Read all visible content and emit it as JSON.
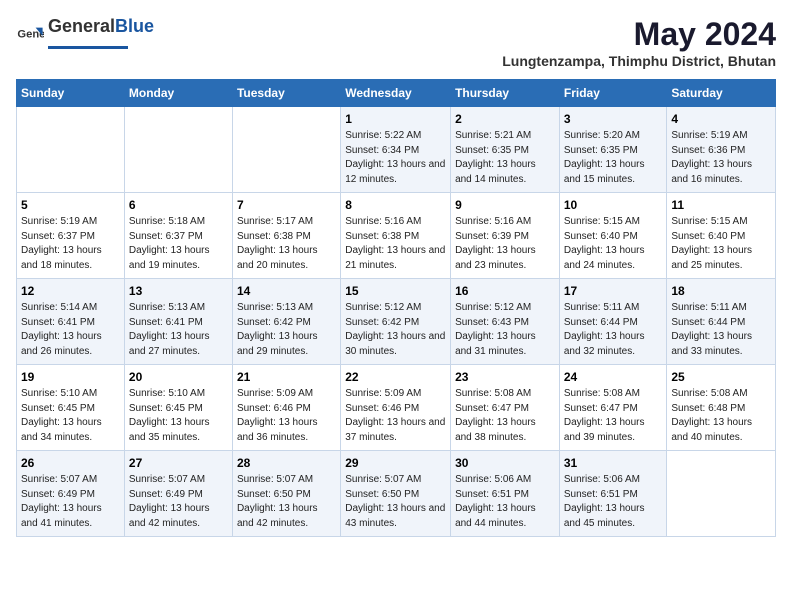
{
  "header": {
    "logo_general": "General",
    "logo_blue": "Blue",
    "title": "May 2024",
    "subtitle": "Lungtenzampa, Thimphu District, Bhutan"
  },
  "weekdays": [
    "Sunday",
    "Monday",
    "Tuesday",
    "Wednesday",
    "Thursday",
    "Friday",
    "Saturday"
  ],
  "weeks": [
    [
      {
        "day": "",
        "sunrise": "",
        "sunset": "",
        "daylight": ""
      },
      {
        "day": "",
        "sunrise": "",
        "sunset": "",
        "daylight": ""
      },
      {
        "day": "",
        "sunrise": "",
        "sunset": "",
        "daylight": ""
      },
      {
        "day": "1",
        "sunrise": "Sunrise: 5:22 AM",
        "sunset": "Sunset: 6:34 PM",
        "daylight": "Daylight: 13 hours and 12 minutes."
      },
      {
        "day": "2",
        "sunrise": "Sunrise: 5:21 AM",
        "sunset": "Sunset: 6:35 PM",
        "daylight": "Daylight: 13 hours and 14 minutes."
      },
      {
        "day": "3",
        "sunrise": "Sunrise: 5:20 AM",
        "sunset": "Sunset: 6:35 PM",
        "daylight": "Daylight: 13 hours and 15 minutes."
      },
      {
        "day": "4",
        "sunrise": "Sunrise: 5:19 AM",
        "sunset": "Sunset: 6:36 PM",
        "daylight": "Daylight: 13 hours and 16 minutes."
      }
    ],
    [
      {
        "day": "5",
        "sunrise": "Sunrise: 5:19 AM",
        "sunset": "Sunset: 6:37 PM",
        "daylight": "Daylight: 13 hours and 18 minutes."
      },
      {
        "day": "6",
        "sunrise": "Sunrise: 5:18 AM",
        "sunset": "Sunset: 6:37 PM",
        "daylight": "Daylight: 13 hours and 19 minutes."
      },
      {
        "day": "7",
        "sunrise": "Sunrise: 5:17 AM",
        "sunset": "Sunset: 6:38 PM",
        "daylight": "Daylight: 13 hours and 20 minutes."
      },
      {
        "day": "8",
        "sunrise": "Sunrise: 5:16 AM",
        "sunset": "Sunset: 6:38 PM",
        "daylight": "Daylight: 13 hours and 21 minutes."
      },
      {
        "day": "9",
        "sunrise": "Sunrise: 5:16 AM",
        "sunset": "Sunset: 6:39 PM",
        "daylight": "Daylight: 13 hours and 23 minutes."
      },
      {
        "day": "10",
        "sunrise": "Sunrise: 5:15 AM",
        "sunset": "Sunset: 6:40 PM",
        "daylight": "Daylight: 13 hours and 24 minutes."
      },
      {
        "day": "11",
        "sunrise": "Sunrise: 5:15 AM",
        "sunset": "Sunset: 6:40 PM",
        "daylight": "Daylight: 13 hours and 25 minutes."
      }
    ],
    [
      {
        "day": "12",
        "sunrise": "Sunrise: 5:14 AM",
        "sunset": "Sunset: 6:41 PM",
        "daylight": "Daylight: 13 hours and 26 minutes."
      },
      {
        "day": "13",
        "sunrise": "Sunrise: 5:13 AM",
        "sunset": "Sunset: 6:41 PM",
        "daylight": "Daylight: 13 hours and 27 minutes."
      },
      {
        "day": "14",
        "sunrise": "Sunrise: 5:13 AM",
        "sunset": "Sunset: 6:42 PM",
        "daylight": "Daylight: 13 hours and 29 minutes."
      },
      {
        "day": "15",
        "sunrise": "Sunrise: 5:12 AM",
        "sunset": "Sunset: 6:42 PM",
        "daylight": "Daylight: 13 hours and 30 minutes."
      },
      {
        "day": "16",
        "sunrise": "Sunrise: 5:12 AM",
        "sunset": "Sunset: 6:43 PM",
        "daylight": "Daylight: 13 hours and 31 minutes."
      },
      {
        "day": "17",
        "sunrise": "Sunrise: 5:11 AM",
        "sunset": "Sunset: 6:44 PM",
        "daylight": "Daylight: 13 hours and 32 minutes."
      },
      {
        "day": "18",
        "sunrise": "Sunrise: 5:11 AM",
        "sunset": "Sunset: 6:44 PM",
        "daylight": "Daylight: 13 hours and 33 minutes."
      }
    ],
    [
      {
        "day": "19",
        "sunrise": "Sunrise: 5:10 AM",
        "sunset": "Sunset: 6:45 PM",
        "daylight": "Daylight: 13 hours and 34 minutes."
      },
      {
        "day": "20",
        "sunrise": "Sunrise: 5:10 AM",
        "sunset": "Sunset: 6:45 PM",
        "daylight": "Daylight: 13 hours and 35 minutes."
      },
      {
        "day": "21",
        "sunrise": "Sunrise: 5:09 AM",
        "sunset": "Sunset: 6:46 PM",
        "daylight": "Daylight: 13 hours and 36 minutes."
      },
      {
        "day": "22",
        "sunrise": "Sunrise: 5:09 AM",
        "sunset": "Sunset: 6:46 PM",
        "daylight": "Daylight: 13 hours and 37 minutes."
      },
      {
        "day": "23",
        "sunrise": "Sunrise: 5:08 AM",
        "sunset": "Sunset: 6:47 PM",
        "daylight": "Daylight: 13 hours and 38 minutes."
      },
      {
        "day": "24",
        "sunrise": "Sunrise: 5:08 AM",
        "sunset": "Sunset: 6:47 PM",
        "daylight": "Daylight: 13 hours and 39 minutes."
      },
      {
        "day": "25",
        "sunrise": "Sunrise: 5:08 AM",
        "sunset": "Sunset: 6:48 PM",
        "daylight": "Daylight: 13 hours and 40 minutes."
      }
    ],
    [
      {
        "day": "26",
        "sunrise": "Sunrise: 5:07 AM",
        "sunset": "Sunset: 6:49 PM",
        "daylight": "Daylight: 13 hours and 41 minutes."
      },
      {
        "day": "27",
        "sunrise": "Sunrise: 5:07 AM",
        "sunset": "Sunset: 6:49 PM",
        "daylight": "Daylight: 13 hours and 42 minutes."
      },
      {
        "day": "28",
        "sunrise": "Sunrise: 5:07 AM",
        "sunset": "Sunset: 6:50 PM",
        "daylight": "Daylight: 13 hours and 42 minutes."
      },
      {
        "day": "29",
        "sunrise": "Sunrise: 5:07 AM",
        "sunset": "Sunset: 6:50 PM",
        "daylight": "Daylight: 13 hours and 43 minutes."
      },
      {
        "day": "30",
        "sunrise": "Sunrise: 5:06 AM",
        "sunset": "Sunset: 6:51 PM",
        "daylight": "Daylight: 13 hours and 44 minutes."
      },
      {
        "day": "31",
        "sunrise": "Sunrise: 5:06 AM",
        "sunset": "Sunset: 6:51 PM",
        "daylight": "Daylight: 13 hours and 45 minutes."
      },
      {
        "day": "",
        "sunrise": "",
        "sunset": "",
        "daylight": ""
      }
    ]
  ]
}
